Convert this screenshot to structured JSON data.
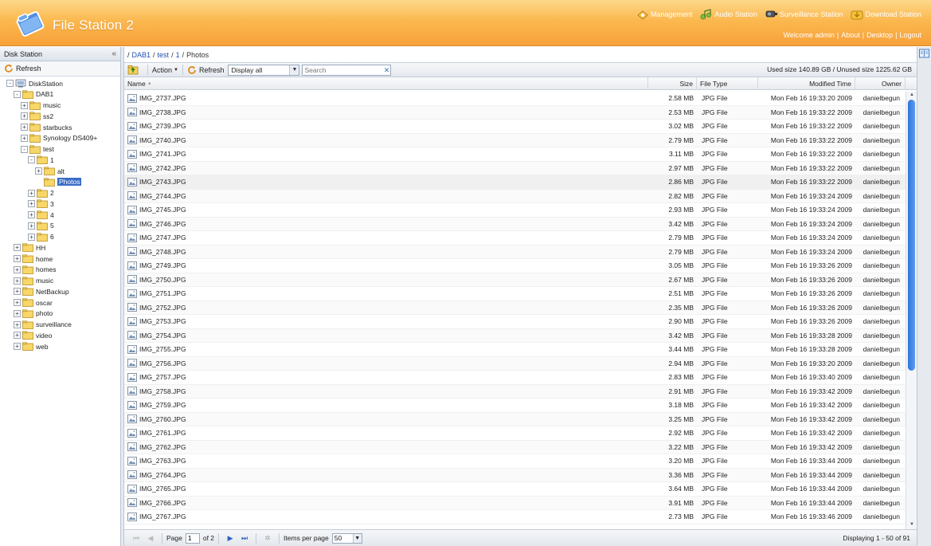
{
  "header": {
    "title": "File Station 2",
    "links": [
      {
        "label": "Management",
        "icon": "management-icon"
      },
      {
        "label": "Audio Station",
        "icon": "audio-station-icon"
      },
      {
        "label": "Surveillance Station",
        "icon": "surveillance-icon"
      },
      {
        "label": "Download Station",
        "icon": "download-station-icon"
      }
    ],
    "welcome": "Welcome admin",
    "about": "About",
    "desktop": "Desktop",
    "logout": "Logout"
  },
  "left": {
    "title": "Disk Station",
    "collapse": "«",
    "refresh": "Refresh",
    "tree": [
      {
        "label": "DiskStation",
        "depth": 0,
        "toggle": "-",
        "type": "server"
      },
      {
        "label": "DAB1",
        "depth": 1,
        "toggle": "-",
        "type": "folder"
      },
      {
        "label": "music",
        "depth": 2,
        "toggle": "+",
        "type": "folder"
      },
      {
        "label": "ss2",
        "depth": 2,
        "toggle": "+",
        "type": "folder"
      },
      {
        "label": "starbucks",
        "depth": 2,
        "toggle": "+",
        "type": "folder"
      },
      {
        "label": "Synology DS409+",
        "depth": 2,
        "toggle": "+",
        "type": "folder"
      },
      {
        "label": "test",
        "depth": 2,
        "toggle": "-",
        "type": "folder"
      },
      {
        "label": "1",
        "depth": 3,
        "toggle": "-",
        "type": "folder"
      },
      {
        "label": "alt",
        "depth": 4,
        "toggle": "+",
        "type": "folder"
      },
      {
        "label": "Photos",
        "depth": 4,
        "toggle": "",
        "type": "folder",
        "selected": true
      },
      {
        "label": "2",
        "depth": 3,
        "toggle": "+",
        "type": "folder"
      },
      {
        "label": "3",
        "depth": 3,
        "toggle": "+",
        "type": "folder"
      },
      {
        "label": "4",
        "depth": 3,
        "toggle": "+",
        "type": "folder"
      },
      {
        "label": "5",
        "depth": 3,
        "toggle": "+",
        "type": "folder"
      },
      {
        "label": "6",
        "depth": 3,
        "toggle": "+",
        "type": "folder"
      },
      {
        "label": "HH",
        "depth": 1,
        "toggle": "+",
        "type": "folder"
      },
      {
        "label": "home",
        "depth": 1,
        "toggle": "+",
        "type": "folder"
      },
      {
        "label": "homes",
        "depth": 1,
        "toggle": "+",
        "type": "folder"
      },
      {
        "label": "music",
        "depth": 1,
        "toggle": "+",
        "type": "folder"
      },
      {
        "label": "NetBackup",
        "depth": 1,
        "toggle": "+",
        "type": "folder"
      },
      {
        "label": "oscar",
        "depth": 1,
        "toggle": "+",
        "type": "folder"
      },
      {
        "label": "photo",
        "depth": 1,
        "toggle": "+",
        "type": "folder"
      },
      {
        "label": "surveillance",
        "depth": 1,
        "toggle": "+",
        "type": "folder"
      },
      {
        "label": "video",
        "depth": 1,
        "toggle": "+",
        "type": "folder"
      },
      {
        "label": "web",
        "depth": 1,
        "toggle": "+",
        "type": "folder"
      }
    ]
  },
  "breadcrumb": {
    "lead": "/",
    "items": [
      "DAB1",
      "test",
      "1"
    ],
    "current": "Photos"
  },
  "toolbar": {
    "action": "Action",
    "refresh": "Refresh",
    "display": "Display all",
    "search_placeholder": "Search",
    "usage": "Used size 140.89 GB / Unused size 1225.62 GB"
  },
  "columns": {
    "name": "Name",
    "size": "Size",
    "type": "File Type",
    "modified": "Modified Time",
    "owner": "Owner"
  },
  "files": [
    {
      "name": "IMG_2737.JPG",
      "size": "2.58 MB",
      "type": "JPG File",
      "modified": "Mon Feb 16 19:33:20 2009",
      "owner": "danielbegun"
    },
    {
      "name": "IMG_2738.JPG",
      "size": "2.53 MB",
      "type": "JPG File",
      "modified": "Mon Feb 16 19:33:22 2009",
      "owner": "danielbegun"
    },
    {
      "name": "IMG_2739.JPG",
      "size": "3.02 MB",
      "type": "JPG File",
      "modified": "Mon Feb 16 19:33:22 2009",
      "owner": "danielbegun"
    },
    {
      "name": "IMG_2740.JPG",
      "size": "2.79 MB",
      "type": "JPG File",
      "modified": "Mon Feb 16 19:33:22 2009",
      "owner": "danielbegun"
    },
    {
      "name": "IMG_2741.JPG",
      "size": "3.11 MB",
      "type": "JPG File",
      "modified": "Mon Feb 16 19:33:22 2009",
      "owner": "danielbegun"
    },
    {
      "name": "IMG_2742.JPG",
      "size": "2.97 MB",
      "type": "JPG File",
      "modified": "Mon Feb 16 19:33:22 2009",
      "owner": "danielbegun"
    },
    {
      "name": "IMG_2743.JPG",
      "size": "2.86 MB",
      "type": "JPG File",
      "modified": "Mon Feb 16 19:33:22 2009",
      "owner": "danielbegun"
    },
    {
      "name": "IMG_2744.JPG",
      "size": "2.82 MB",
      "type": "JPG File",
      "modified": "Mon Feb 16 19:33:24 2009",
      "owner": "danielbegun"
    },
    {
      "name": "IMG_2745.JPG",
      "size": "2.93 MB",
      "type": "JPG File",
      "modified": "Mon Feb 16 19:33:24 2009",
      "owner": "danielbegun"
    },
    {
      "name": "IMG_2746.JPG",
      "size": "3.42 MB",
      "type": "JPG File",
      "modified": "Mon Feb 16 19:33:24 2009",
      "owner": "danielbegun"
    },
    {
      "name": "IMG_2747.JPG",
      "size": "2.79 MB",
      "type": "JPG File",
      "modified": "Mon Feb 16 19:33:24 2009",
      "owner": "danielbegun"
    },
    {
      "name": "IMG_2748.JPG",
      "size": "2.79 MB",
      "type": "JPG File",
      "modified": "Mon Feb 16 19:33:24 2009",
      "owner": "danielbegun"
    },
    {
      "name": "IMG_2749.JPG",
      "size": "3.05 MB",
      "type": "JPG File",
      "modified": "Mon Feb 16 19:33:26 2009",
      "owner": "danielbegun"
    },
    {
      "name": "IMG_2750.JPG",
      "size": "2.67 MB",
      "type": "JPG File",
      "modified": "Mon Feb 16 19:33:26 2009",
      "owner": "danielbegun"
    },
    {
      "name": "IMG_2751.JPG",
      "size": "2.51 MB",
      "type": "JPG File",
      "modified": "Mon Feb 16 19:33:26 2009",
      "owner": "danielbegun"
    },
    {
      "name": "IMG_2752.JPG",
      "size": "2.35 MB",
      "type": "JPG File",
      "modified": "Mon Feb 16 19:33:26 2009",
      "owner": "danielbegun"
    },
    {
      "name": "IMG_2753.JPG",
      "size": "2.90 MB",
      "type": "JPG File",
      "modified": "Mon Feb 16 19:33:26 2009",
      "owner": "danielbegun"
    },
    {
      "name": "IMG_2754.JPG",
      "size": "3.42 MB",
      "type": "JPG File",
      "modified": "Mon Feb 16 19:33:28 2009",
      "owner": "danielbegun"
    },
    {
      "name": "IMG_2755.JPG",
      "size": "3.44 MB",
      "type": "JPG File",
      "modified": "Mon Feb 16 19:33:28 2009",
      "owner": "danielbegun"
    },
    {
      "name": "IMG_2756.JPG",
      "size": "2.94 MB",
      "type": "JPG File",
      "modified": "Mon Feb 16 19:33:20 2009",
      "owner": "danielbegun"
    },
    {
      "name": "IMG_2757.JPG",
      "size": "2.83 MB",
      "type": "JPG File",
      "modified": "Mon Feb 16 19:33:40 2009",
      "owner": "danielbegun"
    },
    {
      "name": "IMG_2758.JPG",
      "size": "2.91 MB",
      "type": "JPG File",
      "modified": "Mon Feb 16 19:33:42 2009",
      "owner": "danielbegun"
    },
    {
      "name": "IMG_2759.JPG",
      "size": "3.18 MB",
      "type": "JPG File",
      "modified": "Mon Feb 16 19:33:42 2009",
      "owner": "danielbegun"
    },
    {
      "name": "IMG_2760.JPG",
      "size": "3.25 MB",
      "type": "JPG File",
      "modified": "Mon Feb 16 19:33:42 2009",
      "owner": "danielbegun"
    },
    {
      "name": "IMG_2761.JPG",
      "size": "2.92 MB",
      "type": "JPG File",
      "modified": "Mon Feb 16 19:33:42 2009",
      "owner": "danielbegun"
    },
    {
      "name": "IMG_2762.JPG",
      "size": "3.22 MB",
      "type": "JPG File",
      "modified": "Mon Feb 16 19:33:42 2009",
      "owner": "danielbegun"
    },
    {
      "name": "IMG_2763.JPG",
      "size": "3.20 MB",
      "type": "JPG File",
      "modified": "Mon Feb 16 19:33:44 2009",
      "owner": "danielbegun"
    },
    {
      "name": "IMG_2764.JPG",
      "size": "3.36 MB",
      "type": "JPG File",
      "modified": "Mon Feb 16 19:33:44 2009",
      "owner": "danielbegun"
    },
    {
      "name": "IMG_2765.JPG",
      "size": "3.64 MB",
      "type": "JPG File",
      "modified": "Mon Feb 16 19:33:44 2009",
      "owner": "danielbegun"
    },
    {
      "name": "IMG_2766.JPG",
      "size": "3.91 MB",
      "type": "JPG File",
      "modified": "Mon Feb 16 19:33:44 2009",
      "owner": "danielbegun"
    },
    {
      "name": "IMG_2767.JPG",
      "size": "2.73 MB",
      "type": "JPG File",
      "modified": "Mon Feb 16 19:33:46 2009",
      "owner": "danielbegun"
    }
  ],
  "pager": {
    "page_label": "Page",
    "page": "1",
    "of": "of 2",
    "per_page_label": "Items per page",
    "per_page": "50",
    "displaying": "Displaying 1 - 50 of 91"
  },
  "colors": {
    "header_top": "#fdd88a",
    "header_bottom": "#f7a13a",
    "link_blue": "#1e4fb0",
    "selection": "#3b6cc7",
    "scroll_thumb": "#2f74d8"
  }
}
